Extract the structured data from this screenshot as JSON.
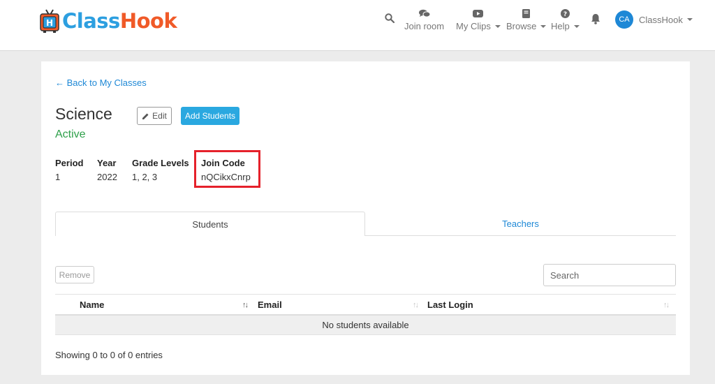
{
  "header": {
    "logo": {
      "part1": "Class",
      "part2": "Hook",
      "tv_glyph": "H"
    },
    "nav": [
      {
        "label": "Join room",
        "icon": "chat-icon",
        "dropdown": false
      },
      {
        "label": "My Clips",
        "icon": "video-icon",
        "dropdown": true
      },
      {
        "label": "Browse",
        "icon": "book-icon",
        "dropdown": true
      },
      {
        "label": "Help",
        "icon": "question-icon",
        "dropdown": true
      }
    ],
    "user": {
      "initials": "CA",
      "name": "ClassHook"
    }
  },
  "class_page": {
    "back_link": "← Back to My Classes",
    "title": "Science",
    "status": "Active",
    "edit_label": "Edit",
    "add_students_label": "Add Students",
    "info": {
      "period": {
        "label": "Period",
        "value": "1"
      },
      "year": {
        "label": "Year",
        "value": "2022"
      },
      "grade_levels": {
        "label": "Grade Levels",
        "value": "1, 2, 3"
      },
      "join_code": {
        "label": "Join Code",
        "value": "nQCikxCnrp"
      }
    },
    "tabs": [
      {
        "label": "Students",
        "active": true
      },
      {
        "label": "Teachers",
        "active": false
      }
    ],
    "remove_label": "Remove",
    "search_placeholder": "Search",
    "table": {
      "columns": [
        "Name",
        "Email",
        "Last Login"
      ],
      "empty_message": "No students available"
    },
    "footer": "Showing 0 to 0 of 0 entries"
  },
  "colors": {
    "brand_blue": "#2d9fe0",
    "brand_orange": "#f05a28",
    "link": "#1e88d6",
    "active_green": "#2ea04a",
    "highlight_red": "#e5212b"
  }
}
